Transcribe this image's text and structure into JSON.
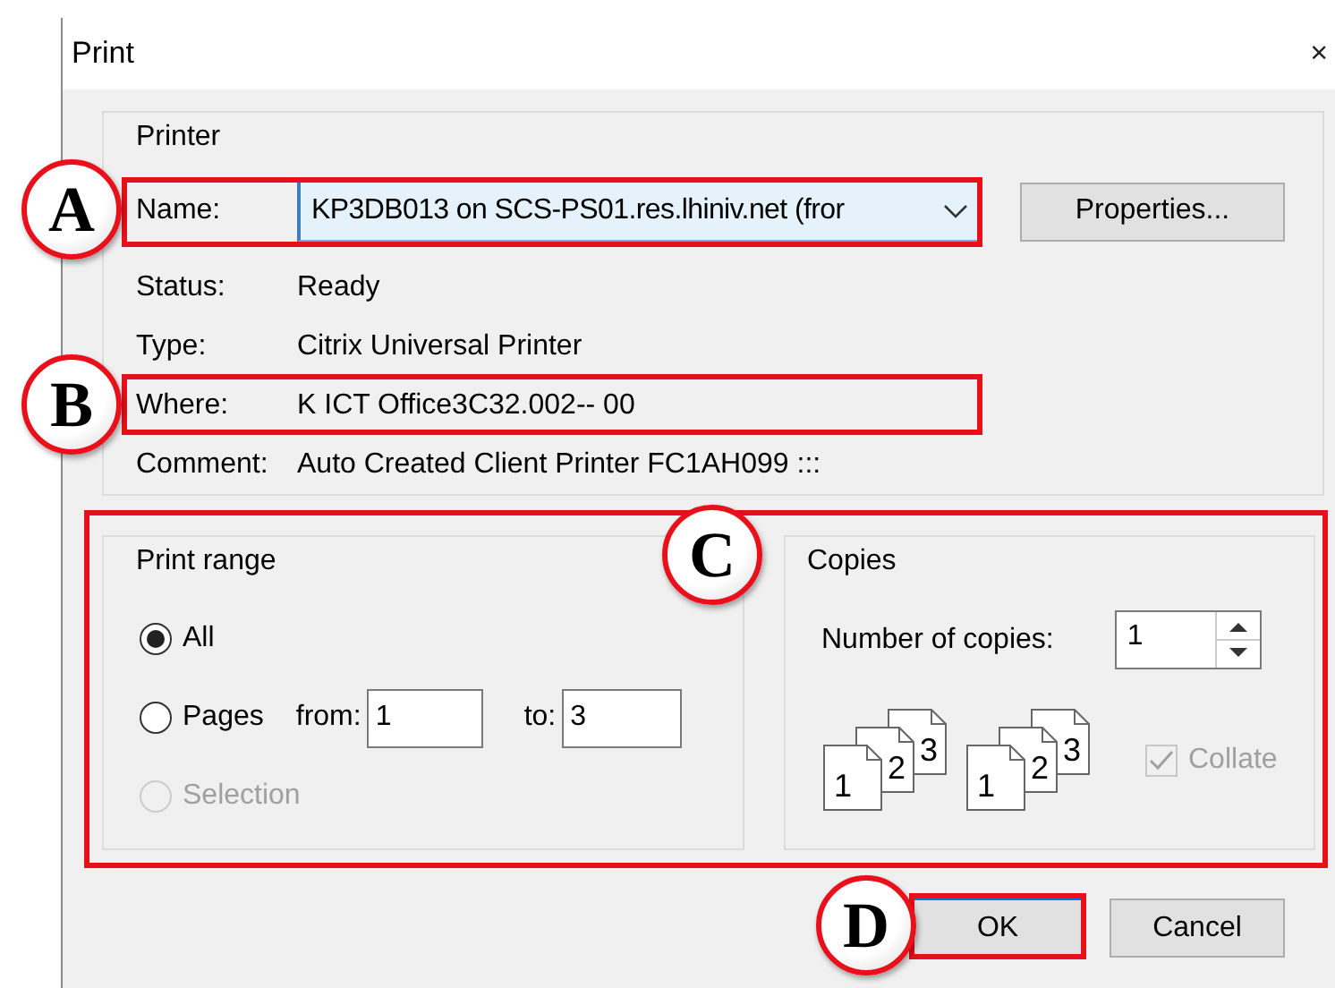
{
  "window": {
    "title": "Print",
    "close": "×"
  },
  "printer": {
    "title": "Printer",
    "name": {
      "label": "Name:",
      "value": "KP3DB013 on SCS-PS01.res.lhiniv.net (fror"
    },
    "properties_button": "Properties...",
    "info": [
      {
        "label": "Status:",
        "value": "Ready"
      },
      {
        "label": "Type:",
        "value": "Citrix Universal Printer"
      },
      {
        "label": "Where:",
        "value": "K ICT Office3C32.002-- 00"
      },
      {
        "label": "Comment:",
        "value": "Auto Created Client Printer FC1AH099 :::"
      }
    ]
  },
  "print_range": {
    "title": "Print range",
    "options": [
      {
        "label": "All",
        "selected": true,
        "disabled": false
      },
      {
        "label": "Pages",
        "selected": false,
        "disabled": false
      },
      {
        "label": "Selection",
        "selected": false,
        "disabled": true
      }
    ],
    "from": {
      "label": "from:",
      "value": "1"
    },
    "to": {
      "label": "to:",
      "value": "3"
    }
  },
  "copies": {
    "title": "Copies",
    "number_label": "Number of copies:",
    "number_value": "1",
    "stacks": [
      {
        "pages": [
          "1",
          "2",
          "3"
        ]
      },
      {
        "pages": [
          "1",
          "2",
          "3"
        ]
      }
    ],
    "collate": {
      "label": "Collate",
      "checked": true,
      "disabled": true
    }
  },
  "buttons": [
    {
      "label": "OK",
      "default": true
    },
    {
      "label": "Cancel",
      "default": false
    }
  ],
  "callouts": [
    {
      "letter": "A"
    },
    {
      "letter": "B"
    },
    {
      "letter": "C"
    },
    {
      "letter": "D"
    }
  ]
}
